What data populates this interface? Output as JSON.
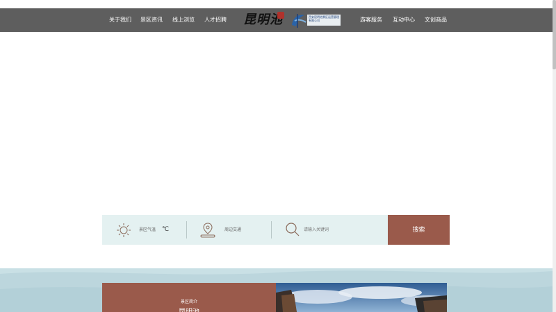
{
  "nav": {
    "left_items": [
      "关于我们",
      "景区资讯",
      "线上浏览",
      "人才招聘"
    ],
    "right_items": [
      "游客服务",
      "互动中心",
      "文创商品"
    ],
    "logo_calligraphy": "昆明池",
    "logo_company": "西安昆明池景区运营管理有限公司"
  },
  "search": {
    "weather_label": "景区气温",
    "temperature": "℃",
    "traffic_label": "周边交通",
    "placeholder": "请输入关键词",
    "button_label": "搜索"
  },
  "intro": {
    "small_label": "景区简介",
    "title": "昆明池"
  },
  "colors": {
    "nav_bg": "#5e5e5e",
    "accent": "#9a5a4b",
    "search_bg": "#e4f1f1",
    "section_bg": "#c5dde3"
  }
}
